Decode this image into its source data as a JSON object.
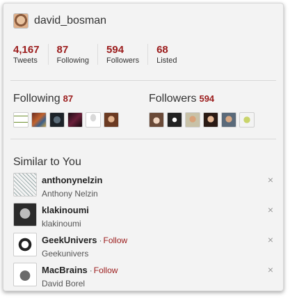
{
  "profile": {
    "username": "david_bosman",
    "avatar_icon": "user-avatar"
  },
  "stats": [
    {
      "value": "4,167",
      "label": "Tweets"
    },
    {
      "value": "87",
      "label": "Following"
    },
    {
      "value": "594",
      "label": "Followers"
    },
    {
      "value": "68",
      "label": "Listed"
    }
  ],
  "following": {
    "title": "Following",
    "count": "87",
    "avatars": [
      "booxeen-logo",
      "books-avatar",
      "dark-globe-avatar",
      "dark-art-avatar",
      "lightbulb-avatar",
      "woman-avatar"
    ]
  },
  "followers": {
    "title": "Followers",
    "count": "594",
    "avatars": [
      "anime-avatar",
      "vk-logo-avatar",
      "person-avatar",
      "woman-avatar",
      "man-avatar",
      "cartoon-avatar"
    ]
  },
  "similar": {
    "title": "Similar to You",
    "close_glyph": "×",
    "follow_label": "Follow",
    "items": [
      {
        "screen_name": "anthonynelzin",
        "name": "Anthony Nelzin",
        "show_follow": false
      },
      {
        "screen_name": "klakinoumi",
        "name": "klakinoumi",
        "show_follow": false
      },
      {
        "screen_name": "GeekUnivers",
        "name": "Geekunivers",
        "show_follow": true
      },
      {
        "screen_name": "MacBrains",
        "name": "David Borel",
        "show_follow": true
      }
    ]
  },
  "colors": {
    "accent": "#9b1b1b",
    "card_bg": "#f3f3f3"
  }
}
